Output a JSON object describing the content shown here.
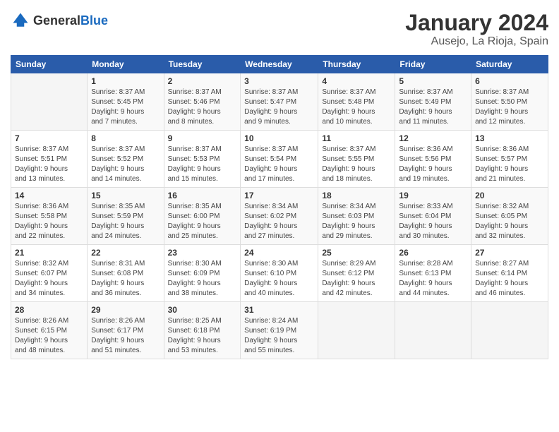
{
  "header": {
    "logo_general": "General",
    "logo_blue": "Blue",
    "title": "January 2024",
    "subtitle": "Ausejo, La Rioja, Spain"
  },
  "columns": [
    "Sunday",
    "Monday",
    "Tuesday",
    "Wednesday",
    "Thursday",
    "Friday",
    "Saturday"
  ],
  "weeks": [
    [
      {
        "day": "",
        "detail": ""
      },
      {
        "day": "1",
        "detail": "Sunrise: 8:37 AM\nSunset: 5:45 PM\nDaylight: 9 hours\nand 7 minutes."
      },
      {
        "day": "2",
        "detail": "Sunrise: 8:37 AM\nSunset: 5:46 PM\nDaylight: 9 hours\nand 8 minutes."
      },
      {
        "day": "3",
        "detail": "Sunrise: 8:37 AM\nSunset: 5:47 PM\nDaylight: 9 hours\nand 9 minutes."
      },
      {
        "day": "4",
        "detail": "Sunrise: 8:37 AM\nSunset: 5:48 PM\nDaylight: 9 hours\nand 10 minutes."
      },
      {
        "day": "5",
        "detail": "Sunrise: 8:37 AM\nSunset: 5:49 PM\nDaylight: 9 hours\nand 11 minutes."
      },
      {
        "day": "6",
        "detail": "Sunrise: 8:37 AM\nSunset: 5:50 PM\nDaylight: 9 hours\nand 12 minutes."
      }
    ],
    [
      {
        "day": "7",
        "detail": "Sunrise: 8:37 AM\nSunset: 5:51 PM\nDaylight: 9 hours\nand 13 minutes."
      },
      {
        "day": "8",
        "detail": "Sunrise: 8:37 AM\nSunset: 5:52 PM\nDaylight: 9 hours\nand 14 minutes."
      },
      {
        "day": "9",
        "detail": "Sunrise: 8:37 AM\nSunset: 5:53 PM\nDaylight: 9 hours\nand 15 minutes."
      },
      {
        "day": "10",
        "detail": "Sunrise: 8:37 AM\nSunset: 5:54 PM\nDaylight: 9 hours\nand 17 minutes."
      },
      {
        "day": "11",
        "detail": "Sunrise: 8:37 AM\nSunset: 5:55 PM\nDaylight: 9 hours\nand 18 minutes."
      },
      {
        "day": "12",
        "detail": "Sunrise: 8:36 AM\nSunset: 5:56 PM\nDaylight: 9 hours\nand 19 minutes."
      },
      {
        "day": "13",
        "detail": "Sunrise: 8:36 AM\nSunset: 5:57 PM\nDaylight: 9 hours\nand 21 minutes."
      }
    ],
    [
      {
        "day": "14",
        "detail": "Sunrise: 8:36 AM\nSunset: 5:58 PM\nDaylight: 9 hours\nand 22 minutes."
      },
      {
        "day": "15",
        "detail": "Sunrise: 8:35 AM\nSunset: 5:59 PM\nDaylight: 9 hours\nand 24 minutes."
      },
      {
        "day": "16",
        "detail": "Sunrise: 8:35 AM\nSunset: 6:00 PM\nDaylight: 9 hours\nand 25 minutes."
      },
      {
        "day": "17",
        "detail": "Sunrise: 8:34 AM\nSunset: 6:02 PM\nDaylight: 9 hours\nand 27 minutes."
      },
      {
        "day": "18",
        "detail": "Sunrise: 8:34 AM\nSunset: 6:03 PM\nDaylight: 9 hours\nand 29 minutes."
      },
      {
        "day": "19",
        "detail": "Sunrise: 8:33 AM\nSunset: 6:04 PM\nDaylight: 9 hours\nand 30 minutes."
      },
      {
        "day": "20",
        "detail": "Sunrise: 8:32 AM\nSunset: 6:05 PM\nDaylight: 9 hours\nand 32 minutes."
      }
    ],
    [
      {
        "day": "21",
        "detail": "Sunrise: 8:32 AM\nSunset: 6:07 PM\nDaylight: 9 hours\nand 34 minutes."
      },
      {
        "day": "22",
        "detail": "Sunrise: 8:31 AM\nSunset: 6:08 PM\nDaylight: 9 hours\nand 36 minutes."
      },
      {
        "day": "23",
        "detail": "Sunrise: 8:30 AM\nSunset: 6:09 PM\nDaylight: 9 hours\nand 38 minutes."
      },
      {
        "day": "24",
        "detail": "Sunrise: 8:30 AM\nSunset: 6:10 PM\nDaylight: 9 hours\nand 40 minutes."
      },
      {
        "day": "25",
        "detail": "Sunrise: 8:29 AM\nSunset: 6:12 PM\nDaylight: 9 hours\nand 42 minutes."
      },
      {
        "day": "26",
        "detail": "Sunrise: 8:28 AM\nSunset: 6:13 PM\nDaylight: 9 hours\nand 44 minutes."
      },
      {
        "day": "27",
        "detail": "Sunrise: 8:27 AM\nSunset: 6:14 PM\nDaylight: 9 hours\nand 46 minutes."
      }
    ],
    [
      {
        "day": "28",
        "detail": "Sunrise: 8:26 AM\nSunset: 6:15 PM\nDaylight: 9 hours\nand 48 minutes."
      },
      {
        "day": "29",
        "detail": "Sunrise: 8:26 AM\nSunset: 6:17 PM\nDaylight: 9 hours\nand 51 minutes."
      },
      {
        "day": "30",
        "detail": "Sunrise: 8:25 AM\nSunset: 6:18 PM\nDaylight: 9 hours\nand 53 minutes."
      },
      {
        "day": "31",
        "detail": "Sunrise: 8:24 AM\nSunset: 6:19 PM\nDaylight: 9 hours\nand 55 minutes."
      },
      {
        "day": "",
        "detail": ""
      },
      {
        "day": "",
        "detail": ""
      },
      {
        "day": "",
        "detail": ""
      }
    ]
  ]
}
